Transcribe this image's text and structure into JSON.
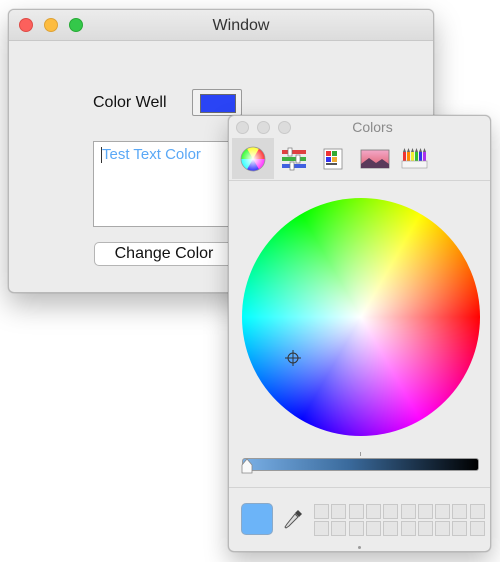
{
  "main_window": {
    "title": "Window",
    "color_well_label": "Color Well",
    "color_well_color": "#2a44f5",
    "text_content": "Test Text Color",
    "text_color": "#5aa8f6",
    "button_label": "Change Color"
  },
  "colors_panel": {
    "title": "Colors",
    "tabs": [
      {
        "icon": "color-wheel-icon",
        "selected": true
      },
      {
        "icon": "color-sliders-icon",
        "selected": false
      },
      {
        "icon": "color-palettes-icon",
        "selected": false
      },
      {
        "icon": "image-palettes-icon",
        "selected": false
      },
      {
        "icon": "crayons-icon",
        "selected": false
      }
    ],
    "brightness": 1.0,
    "current_color": "#6cb4f8",
    "swatch_slots": 20
  }
}
